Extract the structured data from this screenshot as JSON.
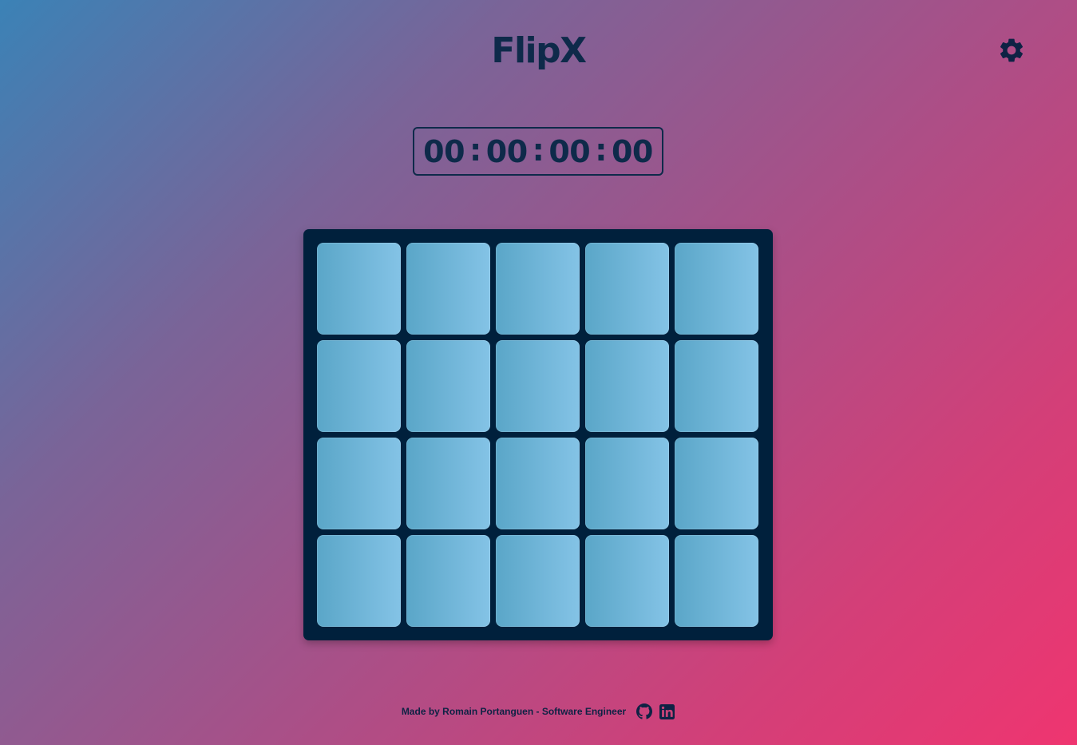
{
  "header": {
    "title": "FlipX",
    "settings_icon": "gear-icon"
  },
  "timer": {
    "segments": [
      "00",
      "00",
      "00",
      "00"
    ],
    "separator": ":"
  },
  "board": {
    "rows": 4,
    "columns": 5,
    "card_color_left": "#5aa6c8",
    "card_color_right": "#84c3e6",
    "background": "#00203c"
  },
  "footer": {
    "credit": "Made by Romain Portanguen - Software Engineer",
    "icons": [
      "github-icon",
      "linkedin-icon"
    ]
  }
}
